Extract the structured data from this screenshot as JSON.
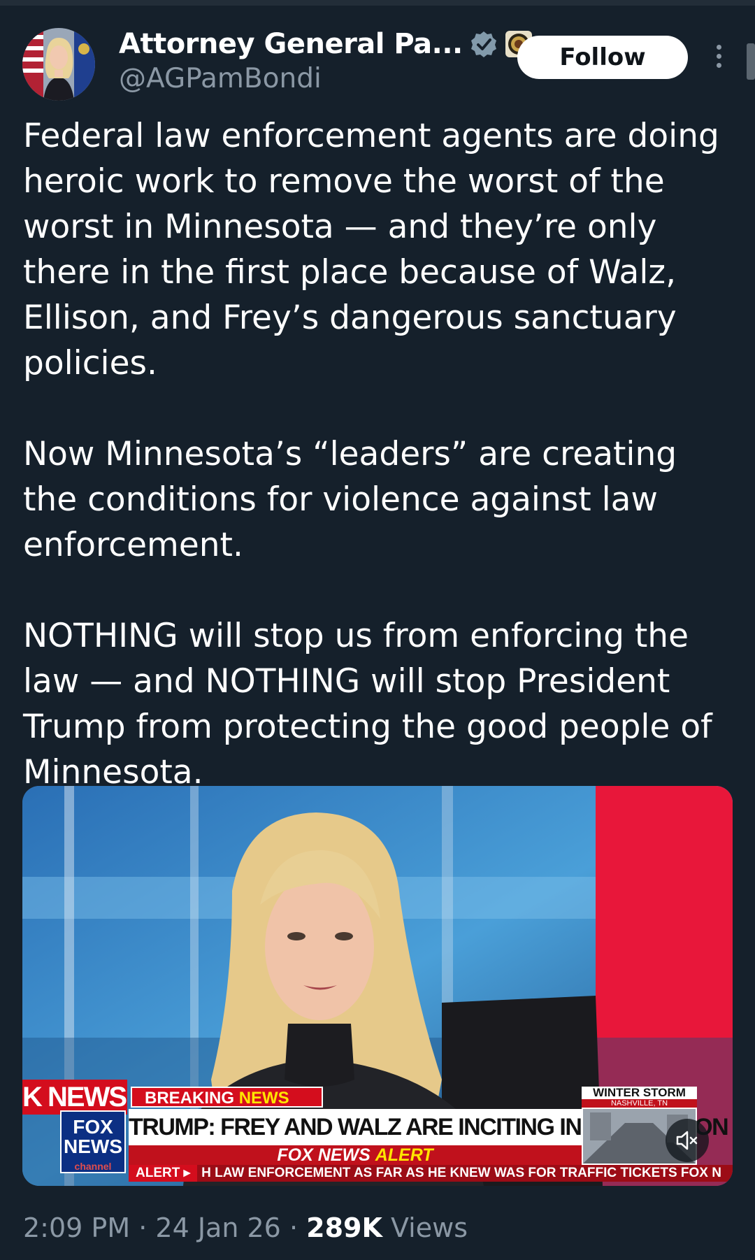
{
  "author": {
    "display_name": "Attorney General Pa...",
    "handle": "@AGPamBondi"
  },
  "actions": {
    "follow_label": "Follow"
  },
  "tweet": {
    "paragraphs": [
      "Federal law enforcement agents are doing heroic work to remove the worst of the worst in Minnesota — and they’re only there in the first place because of Walz, Ellison, and Frey’s dangerous sanctuary policies.",
      "Now Minnesota’s “leaders” are creating the conditions for violence against law enforcement.",
      "NOTHING will stop us from enforcing the law — and NOTHING will stop President Trump from protecting the good people of Minnesota."
    ]
  },
  "video": {
    "network_tag": "K NEWS",
    "breaking_prefix": "BREAKING",
    "breaking_suffix": "NEWS",
    "headline": "TRUMP: FREY AND WALZ ARE INCITING INSURRECTION",
    "alert_prefix": "FOX NEWS",
    "alert_suffix": "ALERT",
    "logo_line1": "FOX",
    "logo_line2": "NEWS",
    "logo_line3": "channel",
    "ticker_label": "ALERT ▸",
    "ticker_text": "H LAW ENFORCEMENT AS FAR AS HE KNEW WAS FOR TRAFFIC TICKETS",
    "ticker_logo": "FOX N",
    "storm_title": "WINTER STORM",
    "storm_location": "NASHVILLE, TN",
    "muted": true
  },
  "meta": {
    "time": "2:09 PM",
    "separator": "·",
    "date": "24 Jan 26",
    "views_count": "289K",
    "views_label": "Views"
  },
  "colors": {
    "background": "#15202b",
    "secondary_text": "#8b98a5",
    "fox_red": "#d40d1d",
    "verified_badge": "#829aab"
  }
}
